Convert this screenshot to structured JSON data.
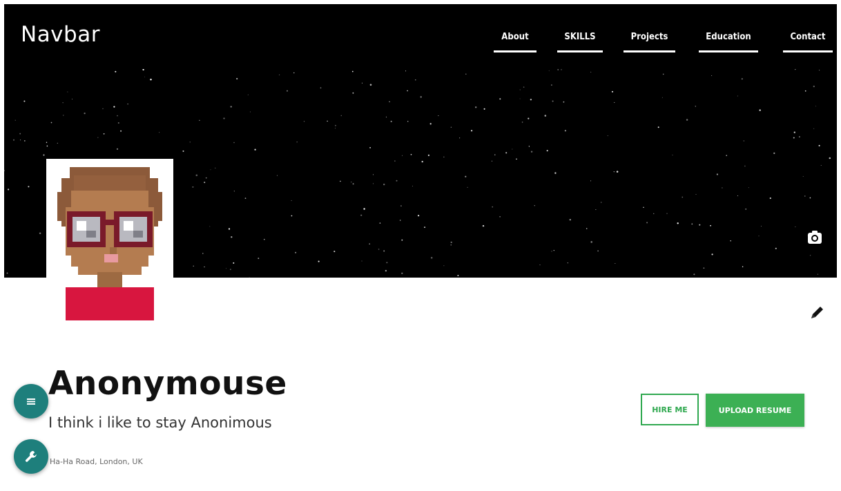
{
  "navbar": {
    "brand": "Navbar",
    "items": [
      {
        "label": "About"
      },
      {
        "label": "SKILLS"
      },
      {
        "label": "Projects"
      },
      {
        "label": "Education"
      },
      {
        "label": "Contact"
      }
    ]
  },
  "cover": {
    "camera_icon": "camera-icon"
  },
  "profile": {
    "name": "Anonymouse",
    "tagline": "I think i like to stay Anonimous",
    "location": "Ha-Ha Road, London, UK"
  },
  "actions": {
    "hire_label": "HIRE ME",
    "upload_label": "UPLOAD RESUME"
  },
  "fab": {
    "menu_icon": "menu-icon",
    "tools_icon": "wrench-icon"
  },
  "colors": {
    "nav_bg": "#000000",
    "accent_green": "#3cb054",
    "fab_teal": "#1e7f7c",
    "avatar_shirt": "#d8163f"
  }
}
